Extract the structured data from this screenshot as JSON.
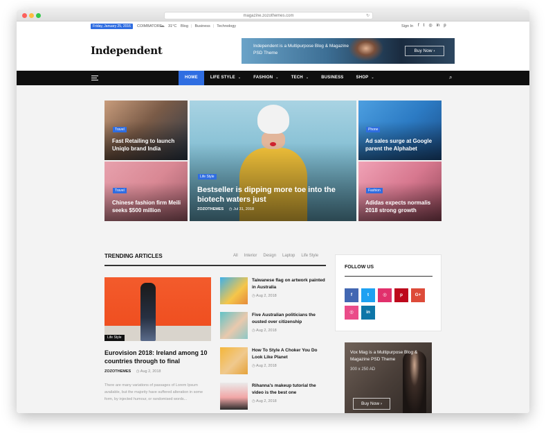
{
  "browser": {
    "url": "magazine.zozothemes.com",
    "reload_icon": "reload-icon"
  },
  "topbar": {
    "date": "Friday, January 25, 2016",
    "location": "COIMBATORE",
    "temperature": "31°C",
    "links": [
      "Blog",
      "Business",
      "Technology"
    ],
    "signin": "Sign In",
    "social_icons": [
      "facebook-icon",
      "twitter-icon",
      "instagram-icon",
      "linkedin-icon",
      "pinterest-icon"
    ],
    "social_glyphs": [
      "f",
      "t",
      "◎",
      "in",
      "p"
    ]
  },
  "header": {
    "logo": "Independent",
    "banner": {
      "text": "Independent is a Multipurpose Blog & Magazine PSD Theme",
      "button": "Buy Now  ›"
    }
  },
  "nav": {
    "items": [
      {
        "label": "HOME",
        "active": true,
        "dropdown": false
      },
      {
        "label": "LIFE STYLE",
        "active": false,
        "dropdown": true
      },
      {
        "label": "FASHION",
        "active": false,
        "dropdown": true
      },
      {
        "label": "TECH",
        "active": false,
        "dropdown": true
      },
      {
        "label": "BUSINESS",
        "active": false,
        "dropdown": false
      },
      {
        "label": "SHOP",
        "active": false,
        "dropdown": true
      }
    ]
  },
  "grid": {
    "tiles": [
      {
        "tag": "Travel",
        "title": "Fast Retailing to launch Uniqlo brand India"
      },
      {
        "tag": "Travel",
        "title": "Chinese fashion firm Meili seeks $500 million"
      },
      {
        "tag": "Life Style",
        "title": "Bestseller is dipping more toe into the biotech waters just",
        "author": "ZOZOTHEMES",
        "date": "Jul 31, 2018"
      },
      {
        "tag": "Phone",
        "title": "Ad sales surge at Google parent the Alphabet"
      },
      {
        "tag": "Fashion",
        "title": "Adidas expects normalis 2018 strong growth"
      }
    ]
  },
  "trending": {
    "heading": "TRENDING ARTICLES",
    "filters": [
      "All",
      "Interior",
      "Design",
      "Laptop",
      "Life Style"
    ],
    "featured": {
      "tag": "Life Style",
      "title": "Eurovision 2018: Ireland among 10 countries through to final",
      "author": "ZOZOTHEMES",
      "date": "Aug 2, 2018",
      "excerpt": "There are many variations of passages of Lorem Ipsum available, but the majority have suffered alteration in some form, by injected humour, or randomised words..."
    },
    "list": [
      {
        "title": "Taiwanese flag on artwork painted in Australia",
        "date": "Aug 2, 2018"
      },
      {
        "title": "Five Australian politicians the ousted over citizenship",
        "date": "Aug 2, 2018"
      },
      {
        "title": "How To Style A Choker You Do Look Like Planet",
        "date": "Aug 2, 2018"
      },
      {
        "title": "Rihanna's makeup tutorial the video is the best one",
        "date": "Aug 2, 2018"
      }
    ]
  },
  "follow": {
    "heading": "FOLLOW US",
    "buttons": [
      {
        "name": "facebook-icon",
        "glyph": "f",
        "color": "#4267b2"
      },
      {
        "name": "twitter-icon",
        "glyph": "t",
        "color": "#1da1f2"
      },
      {
        "name": "instagram-icon",
        "glyph": "◎",
        "color": "#e1306c"
      },
      {
        "name": "pinterest-icon",
        "glyph": "p",
        "color": "#bd081c"
      },
      {
        "name": "google-plus-icon",
        "glyph": "G+",
        "color": "#dd4b39"
      },
      {
        "name": "dribbble-icon",
        "glyph": "◎",
        "color": "#ea4c89"
      },
      {
        "name": "linkedin-icon",
        "glyph": "in",
        "color": "#0e76a8"
      }
    ]
  },
  "ad": {
    "text": "Vox Mag is a Multipurpose Blog & Magazine PSD Theme",
    "size": "300 x 250 AD",
    "button": "Buy Now  ›"
  },
  "colors": {
    "accent": "#2f6de1",
    "nav_bg": "#0f0f0f"
  }
}
